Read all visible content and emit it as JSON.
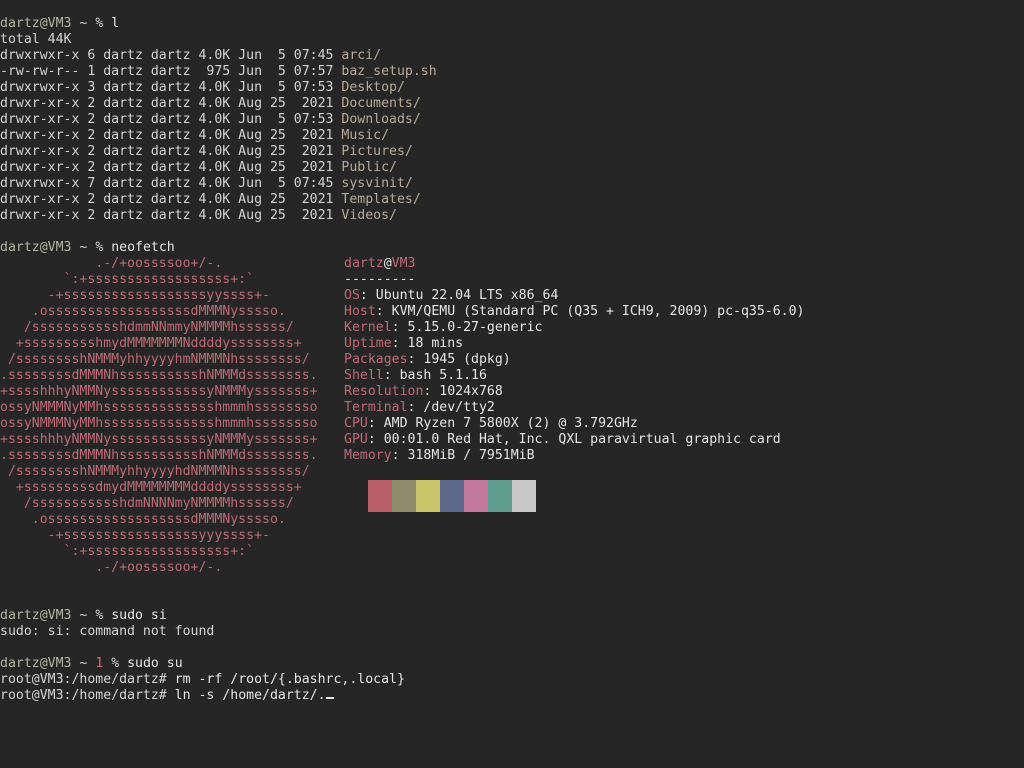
{
  "prompt": {
    "user": "dartz",
    "at": "@",
    "host": "VM3",
    "tilde": " ~",
    "percent": " % ",
    "err_code": " 1 "
  },
  "cmd1": "l",
  "ls": {
    "total": "total 44K",
    "rows": [
      {
        "perm": "drwxrwxr-x 6 dartz dartz 4.0K Jun  5 07:45 ",
        "name": "arci/"
      },
      {
        "perm": "-rw-rw-r-- 1 dartz dartz  975 Jun  5 07:57 ",
        "name": "baz_setup.sh"
      },
      {
        "perm": "drwxrwxr-x 3 dartz dartz 4.0K Jun  5 07:53 ",
        "name": "Desktop/"
      },
      {
        "perm": "drwxr-xr-x 2 dartz dartz 4.0K Aug 25  2021 ",
        "name": "Documents/"
      },
      {
        "perm": "drwxr-xr-x 2 dartz dartz 4.0K Jun  5 07:53 ",
        "name": "Downloads/"
      },
      {
        "perm": "drwxr-xr-x 2 dartz dartz 4.0K Aug 25  2021 ",
        "name": "Music/"
      },
      {
        "perm": "drwxr-xr-x 2 dartz dartz 4.0K Aug 25  2021 ",
        "name": "Pictures/"
      },
      {
        "perm": "drwxr-xr-x 2 dartz dartz 4.0K Aug 25  2021 ",
        "name": "Public/"
      },
      {
        "perm": "drwxrwxr-x 7 dartz dartz 4.0K Jun  5 07:45 ",
        "name": "sysvinit/"
      },
      {
        "perm": "drwxr-xr-x 2 dartz dartz 4.0K Aug 25  2021 ",
        "name": "Templates/"
      },
      {
        "perm": "drwxr-xr-x 2 dartz dartz 4.0K Aug 25  2021 ",
        "name": "Videos/"
      }
    ]
  },
  "cmd2": "neofetch",
  "logo": [
    "            .-/+oossssoo+/-.",
    "        `:+ssssssssssssssssss+:`",
    "      -+ssssssssssssssssssyyssss+-",
    "    .ossssssssssssssssssdMMMNysssso.",
    "   /ssssssssssshdmmNNmmyNMMMMhssssss/",
    "  +ssssssssshmydMMMMMMMNddddyssssssss+",
    " /sssssssshNMMMyhhyyyyhmNMMMNhssssssss/",
    ".ssssssssdMMMNhsssssssssshNMMMdssssssss.",
    "+sssshhhyNMMNyssssssssssssyNMMMysssssss+",
    "ossyNMMMNyMMhsssssssssssssshmmmhssssssso",
    "ossyNMMMNyMMhsssssssssssssshmmmhssssssso",
    "+sssshhhyNMMNyssssssssssssyNMMMysssssss+",
    ".ssssssssdMMMNhsssssssssshNMMMdssssssss.",
    " /sssssssshNMMMyhhyyyyhdNMMMNhssssssss/",
    "  +sssssssssdmydMMMMMMMMddddyssssssss+",
    "   /ssssssssssshdmNNNNmyNMMMMhssssss/",
    "    .ossssssssssssssssssdMMMNysssso.",
    "      -+sssssssssssssssssyyyssss+-",
    "        `:+ssssssssssssssssss+:`",
    "            .-/+oossssoo+/-."
  ],
  "info": {
    "title_user": "dartz",
    "title_at": "@",
    "title_host": "VM3",
    "separator": "---------",
    "rows": [
      {
        "key": "OS",
        "val": ": Ubuntu 22.04 LTS x86_64"
      },
      {
        "key": "Host",
        "val": ": KVM/QEMU (Standard PC (Q35 + ICH9, 2009) pc-q35-6.0)"
      },
      {
        "key": "Kernel",
        "val": ": 5.15.0-27-generic"
      },
      {
        "key": "Uptime",
        "val": ": 18 mins"
      },
      {
        "key": "Packages",
        "val": ": 1945 (dpkg)"
      },
      {
        "key": "Shell",
        "val": ": bash 5.1.16"
      },
      {
        "key": "Resolution",
        "val": ": 1024x768"
      },
      {
        "key": "Terminal",
        "val": ": /dev/tty2"
      },
      {
        "key": "CPU",
        "val": ": AMD Ryzen 7 5800X (2) @ 3.792GHz"
      },
      {
        "key": "GPU",
        "val": ": 00:01.0 Red Hat, Inc. QXL paravirtual graphic card"
      },
      {
        "key": "Memory",
        "val": ": 318MiB / 7951MiB"
      }
    ],
    "palette": [
      "#b85e66",
      "#8c8c6a",
      "#c9c46a",
      "#5e6a8c",
      "#c47a9c",
      "#5e9c8c",
      "#c8c8c8"
    ]
  },
  "cmd3": "sudo si",
  "err3": "sudo: si: command not found",
  "cmd4": "sudo su",
  "root": {
    "prompt": "root@VM3:/home/dartz# ",
    "cmd5": "rm -rf /root/{.bashrc,.local}",
    "cmd6": "ln -s /home/dartz/."
  }
}
